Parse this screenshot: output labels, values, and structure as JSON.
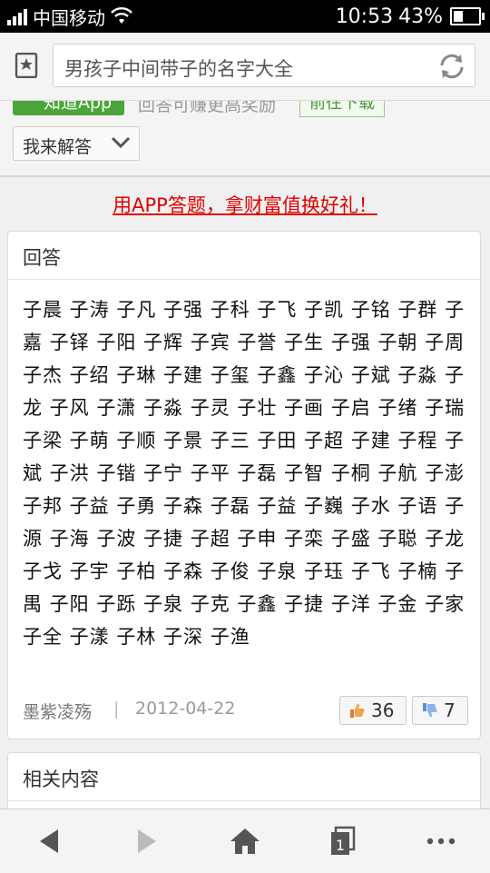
{
  "status_bar": {
    "carrier": "中国移动",
    "time": "10:53",
    "battery": "43%"
  },
  "address_bar": {
    "url_text": "男孩子中间带子的名字大全"
  },
  "top_section": {
    "app_button": "知道App",
    "app_tip": "回答可赚更高奖励",
    "go_button": "前往下载",
    "answer_button": "我来解答"
  },
  "promo_link": "用APP答题，拿财富值换好礼！",
  "answer_card": {
    "title": "回答",
    "names_text": "子晨 子涛 子凡 子强 子科 子飞 子凯 子铭 子群 子嘉 子铎 子阳 子辉 子宾 子誉 子生 子强 子朝 子周 子杰 子绍 子琳 子建 子玺 子鑫 子沁 子斌 子淼 子龙 子风 子潇 子淼 子灵 子壮 子画 子启 子绪 子瑞 子梁 子萌 子顺 子景 子三 子田 子超 子建 子程 子斌 子洪 子锴 子宁 子平 子磊 子智 子桐 子航 子澎 子邦 子益 子勇 子森 子磊 子益 子巍 子水 子语 子源 子海 子波 子捷 子超 子申 子栾 子盛 子聪 子龙 子戈 子宇 子柏 子森 子俊 子泉 子珏 子飞 子楠 子禺 子阳 子跞 子泉 子克 子鑫 子捷 子洋 子金 子家 子全 子漾 子林 子深 子渔",
    "author": "墨紫凌殇",
    "separator": "|",
    "date": "2012-04-22",
    "upvotes": "36",
    "downvotes": "7"
  },
  "related_card": {
    "title": "相关内容"
  },
  "colors": {
    "promo_red": "#e00000",
    "app_green": "#4aa53a"
  }
}
